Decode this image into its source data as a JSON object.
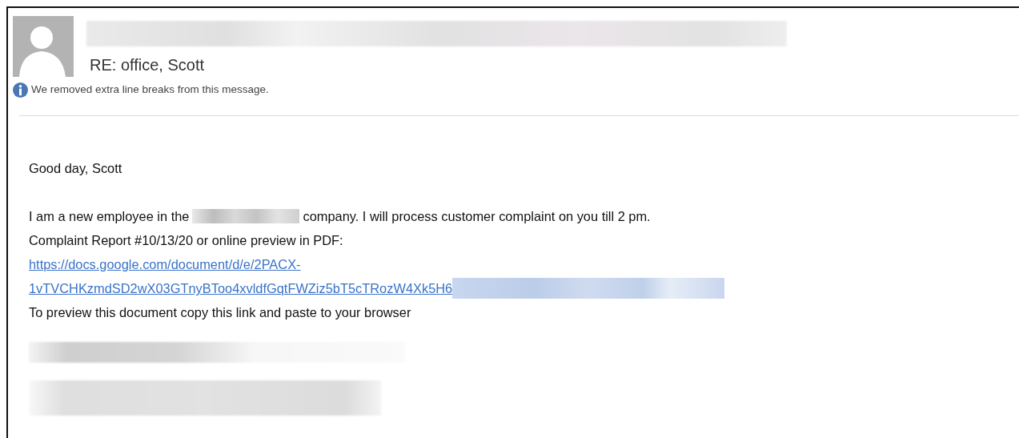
{
  "message": {
    "subject": "RE: office, Scott",
    "info_bar": "We removed extra line breaks from this message.",
    "greeting": "Good day, Scott",
    "body_lines": [
      {
        "kind": "text_redacted",
        "before": "I am a new employee in the",
        "after": "company. I will process customer complaint on you till 2 pm."
      },
      {
        "kind": "text",
        "text": "Complaint Report #10/13/20 or online preview in PDF:"
      },
      {
        "kind": "link",
        "text": "https://docs.google.com/document/d/e/2PACX-"
      },
      {
        "kind": "link_redacted",
        "text": "1vTVCHKzmdSD2wX03GTnyBToo4xvldfGqtFWZiz5bT5cTRozW4Xk5H6"
      },
      {
        "kind": "text",
        "text": "To preview this document copy this link and paste to your browser"
      }
    ]
  }
}
